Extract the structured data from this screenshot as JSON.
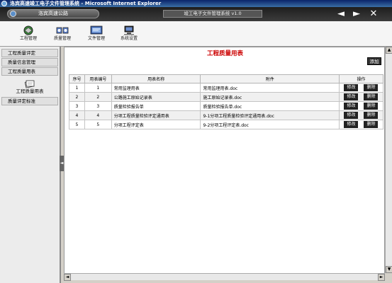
{
  "window": {
    "title": "洛宾高速竣工电子文件管理系统 - Microsoft Internet Explorer"
  },
  "appbar": {
    "road_label": "洛宾高速公路",
    "system_title": "竣工电子文件管理系统 v1.0",
    "back_glyph": "◄",
    "forward_glyph": "►",
    "close_glyph": "✕"
  },
  "toolbar": {
    "items": [
      {
        "label": "工程管理",
        "icon": "project-icon"
      },
      {
        "label": "质量管理",
        "icon": "quality-icon"
      },
      {
        "label": "文件管理",
        "icon": "file-icon"
      },
      {
        "label": "系统设置",
        "icon": "settings-icon"
      }
    ]
  },
  "sidebar": {
    "items": [
      {
        "label": "工程质量评定"
      },
      {
        "label": "质量信息管理"
      },
      {
        "label": "工程质量用表"
      }
    ],
    "selected_sub": {
      "label": "工程质量用表"
    },
    "footer_item": {
      "label": "质量评定标准"
    }
  },
  "main": {
    "title": "工程质量用表",
    "add_label": "添加",
    "columns": [
      "序号",
      "用表编号",
      "用表名称",
      "附件",
      "操作"
    ],
    "rows": [
      {
        "seq": "1",
        "code": "1",
        "name": "常用监理用表",
        "file": "常用监理用表.doc"
      },
      {
        "seq": "2",
        "code": "2",
        "name": "公路施工原始记录表",
        "file": "施工原始记录表.doc"
      },
      {
        "seq": "3",
        "code": "3",
        "name": "质量检验报告单",
        "file": "质量检验报告单.doc"
      },
      {
        "seq": "4",
        "code": "4",
        "name": "分项工程质量检验评定通用表",
        "file": "9-1分项工程质量检验评定通用表.doc"
      },
      {
        "seq": "5",
        "code": "5",
        "name": "分项工程评定表",
        "file": "9-2分项工程评定表.doc"
      }
    ],
    "edit_label": "修改",
    "delete_label": "删除"
  }
}
